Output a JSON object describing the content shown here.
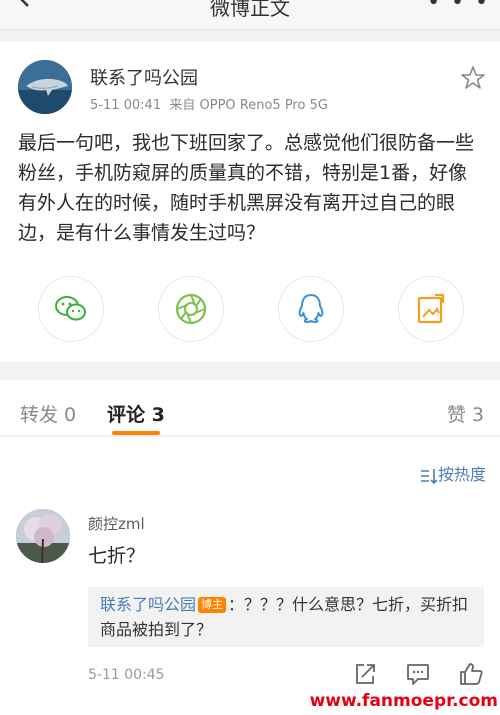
{
  "nav": {
    "title": "微博正文",
    "back_icon": "back-arrow-icon",
    "more_icon": "more-icon"
  },
  "post": {
    "username": "联系了吗公园",
    "timestamp": "5-11 00:41",
    "source": "来自 OPPO Reno5 Pro 5G",
    "text": "最后一句吧，我也下班回家了。总感觉他们很防备一些粉丝，手机防窥屏的质量真的不错，特别是1番，好像有外人在的时候，随时手机黑屏没有离开过自己的眼边，是有什么事情发生过吗？",
    "share_icons": [
      "wechat-icon",
      "moments-icon",
      "qq-icon",
      "screenshot-share-icon"
    ]
  },
  "tabs": {
    "repost": "转发 0",
    "comments": "评论 3",
    "likes": "赞 3"
  },
  "comments": {
    "sort_label": "按热度",
    "items": [
      {
        "user": "颜控zml",
        "text": "七折？",
        "reply": {
          "user": "联系了吗公园",
          "badge": "博主",
          "text": "：？？？什么意思？七折，买折扣商品被拍到了？"
        },
        "time": "5-11 00:45"
      }
    ]
  },
  "watermark": "www.fanmoepr.com",
  "colors": {
    "accent": "#ff8200",
    "link": "#4a7fb5",
    "wechat": "#3cb034",
    "moments": "#7cc24a",
    "qq": "#3d8fd6",
    "watermark": "#e60012"
  }
}
